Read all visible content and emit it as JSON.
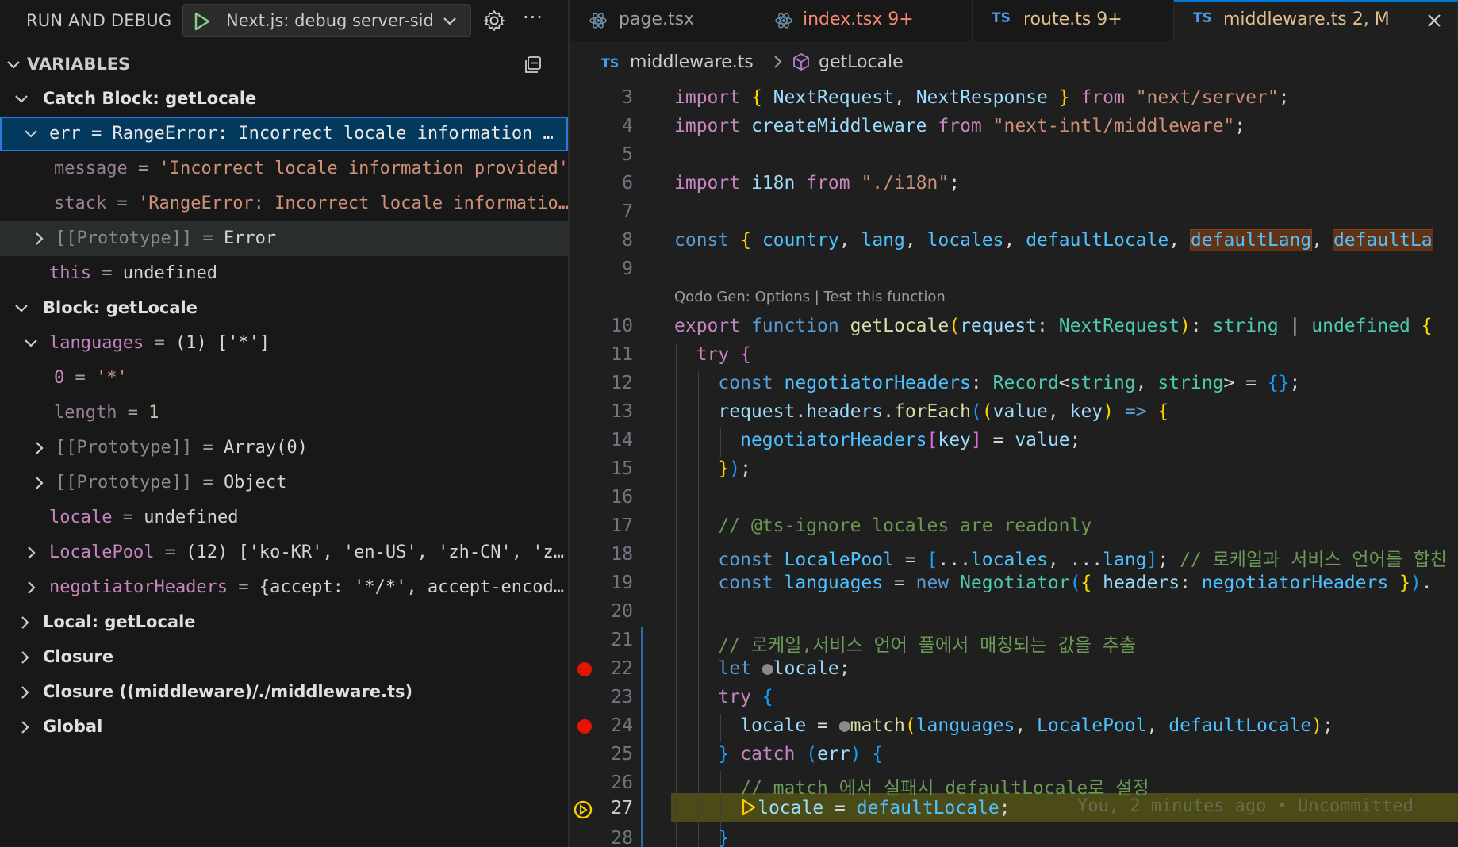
{
  "debug": {
    "title": "RUN AND DEBUG",
    "launch_config": "Next.js: debug server-sid",
    "more": "···"
  },
  "variables": {
    "title": "VARIABLES",
    "rows": [
      {
        "kind": "scope",
        "label": "Catch Block: getLocale"
      },
      {
        "name": "err",
        "eq": "=",
        "value": "RangeError: Incorrect locale information …"
      },
      {
        "name": "message",
        "eq": "=",
        "value": "'Incorrect locale information provided'"
      },
      {
        "name": "stack",
        "eq": "=",
        "value": "'RangeError: Incorrect locale informatio…"
      },
      {
        "name": "[[Prototype]]",
        "eq": "=",
        "value": "Error"
      },
      {
        "name": "this",
        "eq": "=",
        "value": "undefined"
      },
      {
        "kind": "scope",
        "label": "Block: getLocale"
      },
      {
        "name": "languages",
        "eq": "=",
        "value": "(1) ['*']"
      },
      {
        "name": "0",
        "eq": "=",
        "value": "'*'"
      },
      {
        "name": "length",
        "eq": "=",
        "value": "1"
      },
      {
        "name": "[[Prototype]]",
        "eq": "=",
        "value": "Array(0)"
      },
      {
        "name": "[[Prototype]]",
        "eq": "=",
        "value": "Object"
      },
      {
        "name": "locale",
        "eq": "=",
        "value": "undefined"
      },
      {
        "name": "LocalePool",
        "eq": "=",
        "value": "(12) ['ko-KR', 'en-US', 'zh-CN', 'z…"
      },
      {
        "name": "negotiatorHeaders",
        "eq": "=",
        "value": "{accept: '*/*', accept-encod…"
      },
      {
        "kind": "scope",
        "label": "Local: getLocale"
      },
      {
        "kind": "scope",
        "label": "Closure"
      },
      {
        "kind": "scope",
        "label": "Closure ((middleware)/./middleware.ts)"
      },
      {
        "kind": "scope",
        "label": "Global"
      }
    ]
  },
  "tabs": [
    {
      "icon": "react-icon",
      "label": "page.tsx",
      "badge": ""
    },
    {
      "icon": "react-icon",
      "label": "index.tsx",
      "badge": "9+"
    },
    {
      "icon": "TS",
      "label": "route.ts",
      "badge": "9+"
    },
    {
      "icon": "TS",
      "label": "middleware.ts",
      "badge": "2, M"
    }
  ],
  "breadcrumb": {
    "file_icon": "TS",
    "file": "middleware.ts",
    "symbol": "getLocale"
  },
  "editor": {
    "codelens": "Qodo Gen: Options | Test this function",
    "git_blame": "You, 2 minutes ago • Uncommitted",
    "line_numbers": [
      "3",
      "4",
      "5",
      "6",
      "7",
      "8",
      "9",
      "10",
      "11",
      "12",
      "13",
      "14",
      "15",
      "16",
      "17",
      "18",
      "19",
      "20",
      "21",
      "22",
      "23",
      "24",
      "25",
      "26",
      "27",
      "28"
    ],
    "breakpoints": [
      "22",
      "24"
    ],
    "current_line": "27"
  },
  "colors": {
    "accent": "#0078d4",
    "breakpoint": "#e51400",
    "current_line": "#4b4b18",
    "selection": "#04395e"
  }
}
